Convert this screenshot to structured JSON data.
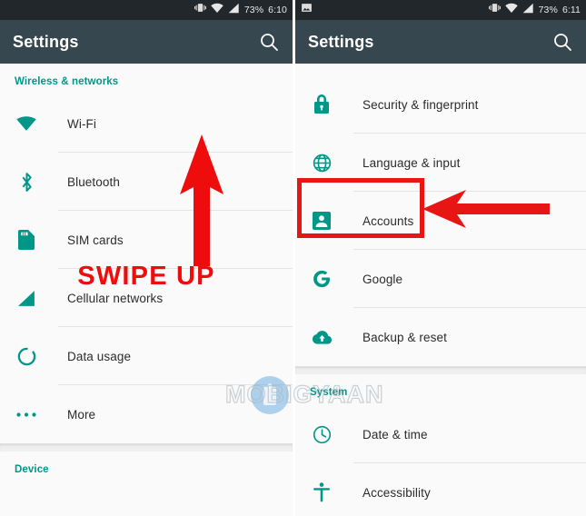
{
  "meta": {
    "watermark_text": "MOBIGYAAN",
    "accent_teal": "#009688",
    "appbar_color": "#37474f",
    "statusbar_color": "#22272b",
    "annotation_red": "#e81515"
  },
  "left_phone": {
    "statusbar": {
      "vibrate_icon": "vibrate-icon",
      "wifi_icon": "wifi-signal-icon",
      "cellular_icon": "cellular-signal-icon",
      "battery_percent": "73%",
      "clock": "6:10"
    },
    "appbar": {
      "title": "Settings",
      "search_icon": "search-icon"
    },
    "sections": [
      {
        "header": "Wireless & networks",
        "rows": [
          {
            "label": "Wi-Fi",
            "icon": "wifi-icon"
          },
          {
            "label": "Bluetooth",
            "icon": "bluetooth-icon"
          },
          {
            "label": "SIM cards",
            "icon": "sim-card-icon"
          },
          {
            "label": "Cellular networks",
            "icon": "cellular-networks-icon"
          },
          {
            "label": "Data usage",
            "icon": "data-usage-icon"
          },
          {
            "label": "More",
            "icon": "more-dots-icon"
          }
        ]
      },
      {
        "header": "Device",
        "rows": []
      }
    ],
    "annotation": {
      "arrow": "swipe-up-arrow",
      "text": "SWIPE UP"
    }
  },
  "right_phone": {
    "statusbar": {
      "screenshot_icon": "screenshot-notification-icon",
      "vibrate_icon": "vibrate-icon",
      "wifi_icon": "wifi-signal-icon",
      "cellular_icon": "cellular-signal-icon",
      "battery_percent": "73%",
      "clock": "6:11"
    },
    "appbar": {
      "title": "Settings",
      "search_icon": "search-icon"
    },
    "sections": [
      {
        "header": "",
        "rows": [
          {
            "label": "Security & fingerprint",
            "icon": "lock-icon"
          },
          {
            "label": "Language & input",
            "icon": "globe-icon"
          },
          {
            "label": "Accounts",
            "icon": "account-person-icon"
          },
          {
            "label": "Google",
            "icon": "google-g-icon"
          },
          {
            "label": "Backup & reset",
            "icon": "cloud-upload-icon"
          }
        ]
      },
      {
        "header": "System",
        "rows": [
          {
            "label": "Date & time",
            "icon": "clock-icon"
          },
          {
            "label": "Accessibility",
            "icon": "accessibility-icon"
          }
        ]
      }
    ],
    "annotation": {
      "highlight_target": "Accounts",
      "arrow": "left-pointing-arrow"
    }
  }
}
